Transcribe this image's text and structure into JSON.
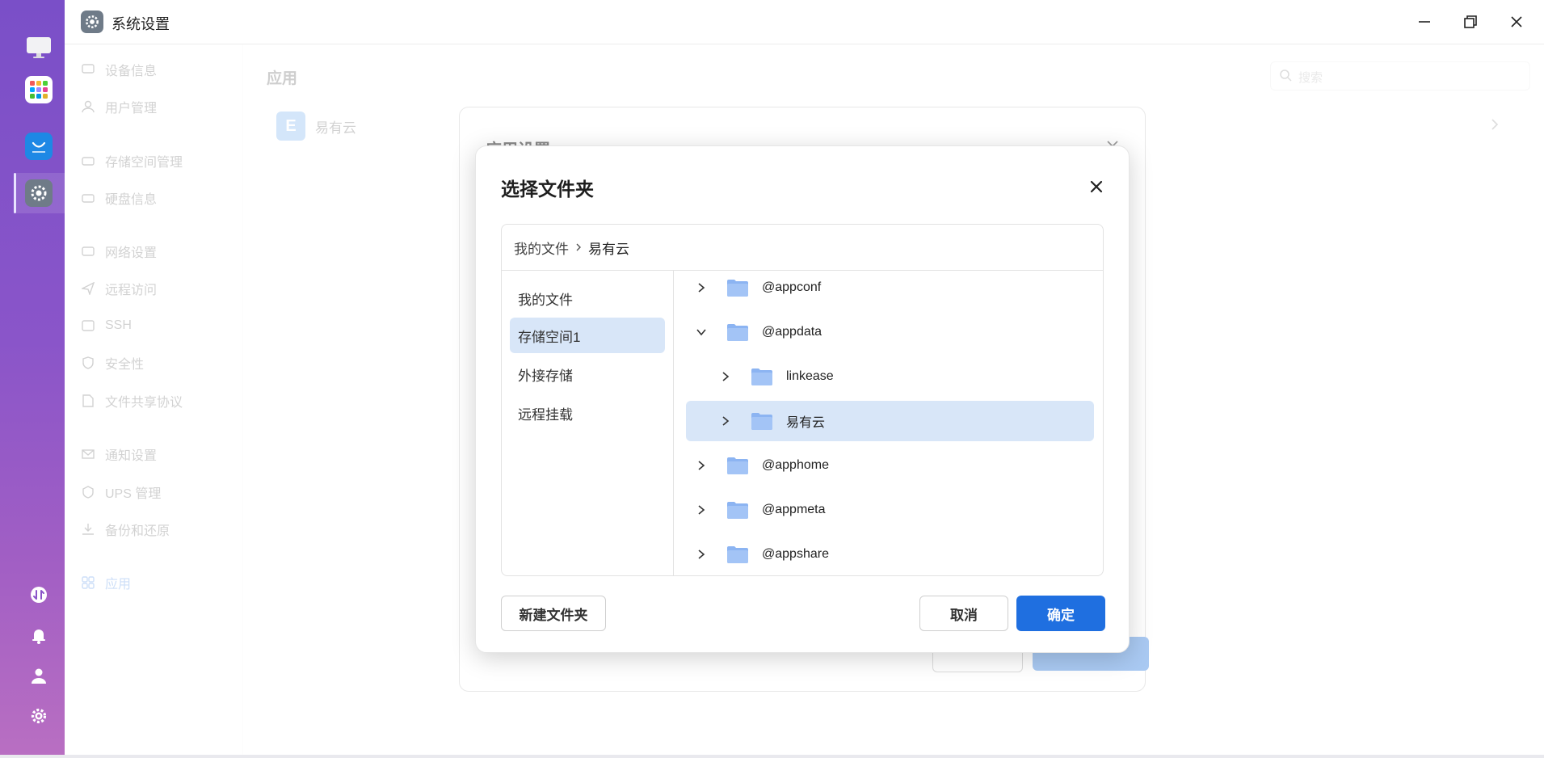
{
  "window": {
    "title": "系统设置"
  },
  "sidebar": {
    "items": [
      {
        "label": "设备信息",
        "icon": "monitor-icon"
      },
      {
        "label": "用户管理",
        "icon": "user-icon"
      },
      {
        "label": "存储空间管理",
        "icon": "storage-icon"
      },
      {
        "label": "硬盘信息",
        "icon": "disk-icon"
      },
      {
        "label": "网络设置",
        "icon": "network-icon"
      },
      {
        "label": "远程访问",
        "icon": "send-icon"
      },
      {
        "label": "SSH",
        "icon": "ssh-icon"
      },
      {
        "label": "安全性",
        "icon": "shield-icon"
      },
      {
        "label": "文件共享协议",
        "icon": "file-icon"
      },
      {
        "label": "通知设置",
        "icon": "mail-icon"
      },
      {
        "label": "UPS 管理",
        "icon": "ups-icon"
      },
      {
        "label": "备份和还原",
        "icon": "backup-icon"
      },
      {
        "label": "应用",
        "icon": "apps-icon"
      }
    ]
  },
  "main": {
    "title": "应用",
    "search_placeholder": "搜索",
    "apps": [
      {
        "name": "易有云",
        "logo_letter": "E"
      }
    ],
    "card_title": "应用设置"
  },
  "dialog": {
    "title": "选择文件夹",
    "breadcrumb": [
      "我的文件",
      "易有云"
    ],
    "locations": [
      {
        "label": "我的文件",
        "selected": false
      },
      {
        "label": "存储空间1",
        "selected": true
      },
      {
        "label": "外接存储",
        "selected": false
      },
      {
        "label": "远程挂载",
        "selected": false
      }
    ],
    "tree": [
      {
        "label": "@appconf",
        "depth": 0,
        "expanded": false,
        "selected": false
      },
      {
        "label": "@appdata",
        "depth": 0,
        "expanded": true,
        "selected": false
      },
      {
        "label": "linkease",
        "depth": 1,
        "expanded": false,
        "selected": false
      },
      {
        "label": "易有云",
        "depth": 1,
        "expanded": false,
        "selected": true
      },
      {
        "label": "@apphome",
        "depth": 0,
        "expanded": false,
        "selected": false
      },
      {
        "label": "@appmeta",
        "depth": 0,
        "expanded": false,
        "selected": false
      },
      {
        "label": "@appshare",
        "depth": 0,
        "expanded": false,
        "selected": false
      }
    ],
    "new_folder_label": "新建文件夹",
    "cancel_label": "取消",
    "ok_label": "确定"
  },
  "colors": {
    "accent": "#1f6fe0",
    "selection": "#d8e6f8",
    "folder": "#8cb4f2",
    "dock": "#8a55c9"
  }
}
